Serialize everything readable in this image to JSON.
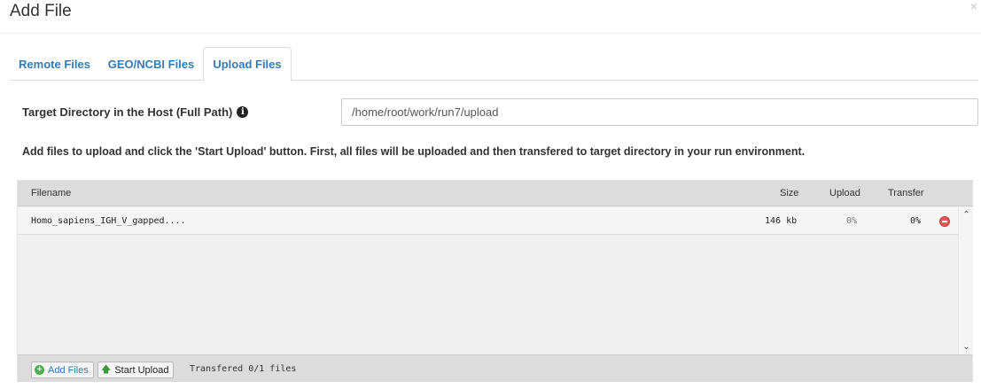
{
  "dialog": {
    "title": "Add File",
    "close_glyph": "×"
  },
  "tabs": [
    {
      "label": "Remote Files",
      "active": false
    },
    {
      "label": "GEO/NCBI Files",
      "active": false
    },
    {
      "label": "Upload Files",
      "active": true
    }
  ],
  "target": {
    "label": "Target Directory in the Host (Full Path)",
    "info_icon": "info-circle-icon",
    "value": "/home/root/work/run7/upload"
  },
  "instructions": "Add files to upload and click the 'Start Upload' button. First, all files will be uploaded and then transfered to target directory in your run environment.",
  "uploader": {
    "columns": {
      "filename": "Filename",
      "size": "Size",
      "upload": "Upload",
      "transfer": "Transfer"
    },
    "files": [
      {
        "filename": "Homo_sapiens_IGH_V_gapped....",
        "size": "146 kb",
        "upload": "0%",
        "transfer": "0%"
      }
    ],
    "buttons": {
      "add": "Add Files",
      "start": "Start Upload"
    },
    "status": "Transfered 0/1 files"
  },
  "colors": {
    "link": "#337ab7",
    "remove": "#e05a5a",
    "add_icon": "#4caf50"
  }
}
